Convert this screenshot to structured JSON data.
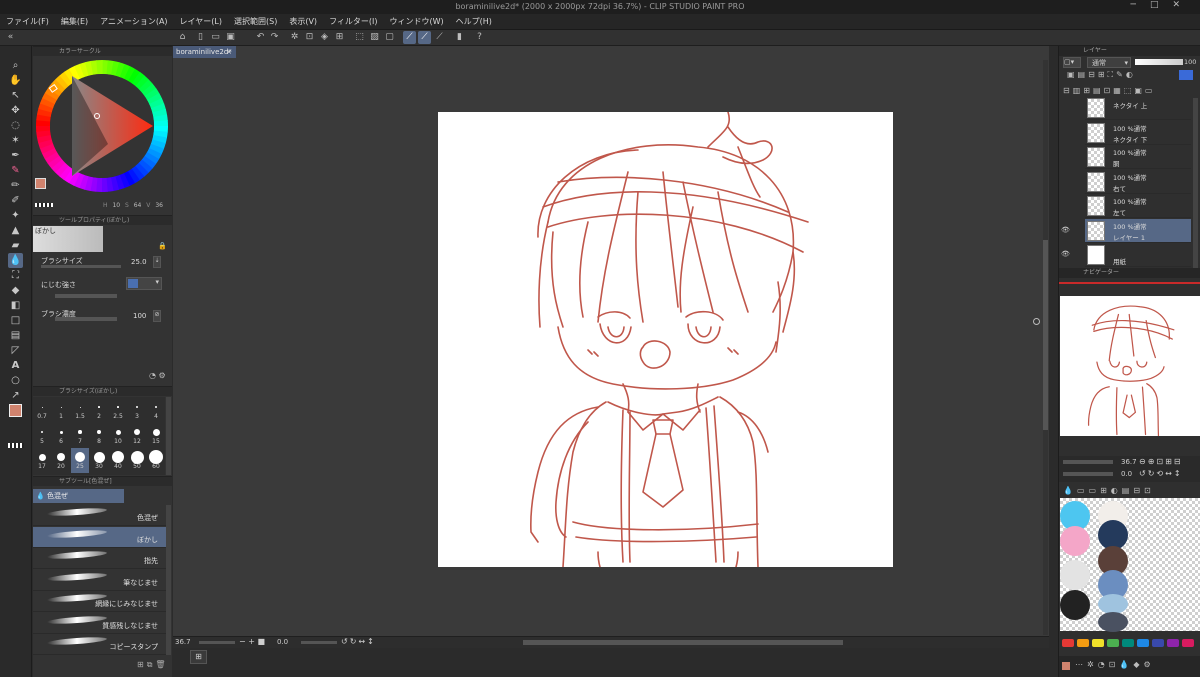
{
  "titlebar": {
    "title": "boraminilive2d* (2000 x 2000px 72dpi 36.7%)  -  CLIP STUDIO PAINT PRO"
  },
  "menu": [
    "ファイル(F)",
    "編集(E)",
    "アニメーション(A)",
    "レイヤー(L)",
    "選択範囲(S)",
    "表示(V)",
    "フィルター(I)",
    "ウィンドウ(W)",
    "ヘルプ(H)"
  ],
  "canvas": {
    "tab_label": "boraminilive2d*",
    "tab_close": "×",
    "zoom": "36.7",
    "angle": "0.0"
  },
  "color_circle": {
    "title": "カラーサークル",
    "h": "10",
    "s": "64",
    "v": "36",
    "main_color": "#d0836e",
    "sub_color": "#ffffff"
  },
  "tool_property": {
    "title": "ツールプロパティ(ぼかし)",
    "tool_name": "ぼかし",
    "brush_size_label": "ブラシサイズ",
    "brush_size_value": "25.0",
    "blend_label": "にじむ強さ",
    "density_label": "ブラシ濃度",
    "density_value": "100"
  },
  "brush_size_panel": {
    "title": "ブラシサイズ(ぼかし)",
    "rows": [
      [
        "0.7",
        "1",
        "1.5",
        "2",
        "2.5",
        "3",
        "4"
      ],
      [
        "5",
        "6",
        "7",
        "8",
        "10",
        "12",
        "15"
      ],
      [
        "17",
        "20",
        "25",
        "30",
        "40",
        "50",
        "60"
      ]
    ],
    "selected": "25"
  },
  "subtool": {
    "title": "サブツール[色混ぜ]",
    "group": "色混ぜ",
    "items": [
      "色混ぜ",
      "ぼかし",
      "指先",
      "筆なじませ",
      "網縁にじみなじませ",
      "質感残しなじませ",
      "コピースタンプ"
    ],
    "selected": "ぼかし"
  },
  "layer_panel": {
    "title": "レイヤー",
    "blend_mode": "通常",
    "opacity": "100",
    "layers": [
      {
        "name": "ネクタイ 上",
        "mode": ""
      },
      {
        "name": "ネクタイ 下",
        "mode": "100 %通常"
      },
      {
        "name": "胴",
        "mode": "100 %通常"
      },
      {
        "name": "右て",
        "mode": "100 %通常"
      },
      {
        "name": "左て",
        "mode": "100 %通常"
      },
      {
        "name": "レイヤー 1",
        "mode": "100 %通常"
      },
      {
        "name": "用紙",
        "mode": ""
      }
    ],
    "selected": "レイヤー 1"
  },
  "navigator": {
    "title": "ナビゲーター",
    "zoom": "36.7",
    "angle": "0.0"
  },
  "palette": {
    "swatches": [
      "#4dc6f0",
      "#f2eeea",
      "#f4a6c8",
      "#243a5c",
      "#e3e3e3",
      "#5a4039",
      "#222222",
      "#6b8ec0",
      "#9fc3df",
      "#4a5161"
    ],
    "bar_colors": [
      "#e53935",
      "#f39c12",
      "#f1e12a",
      "#4caf50",
      "#00897b",
      "#1e88e5",
      "#3949ab",
      "#8e24aa",
      "#d81b60"
    ]
  },
  "line_color": "#c0574b"
}
